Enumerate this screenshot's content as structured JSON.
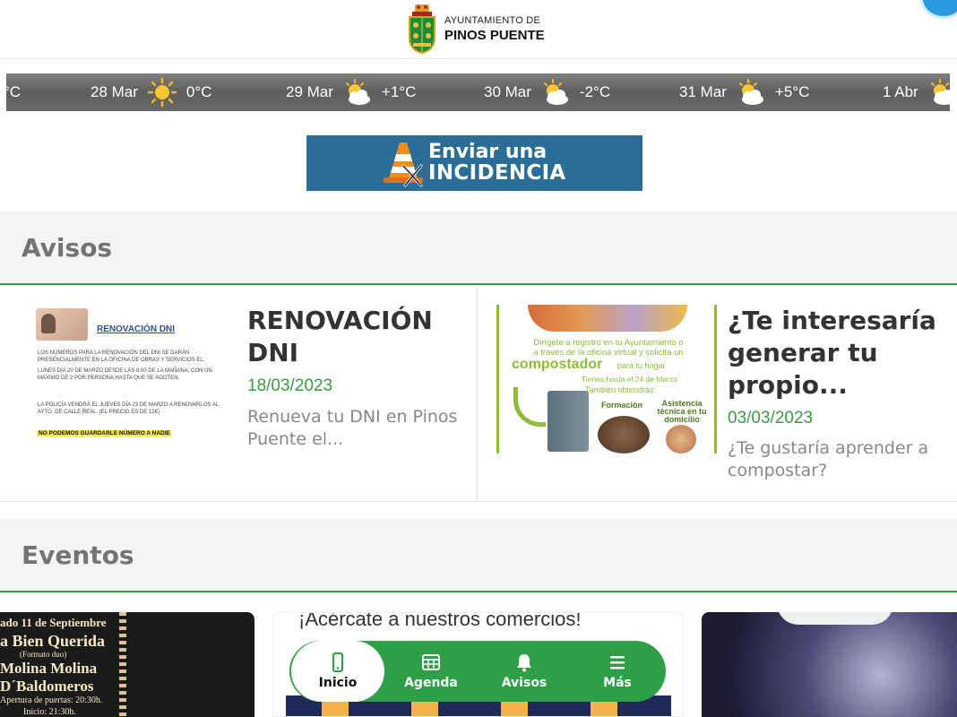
{
  "header": {
    "logo_line1": "AYUNTAMIENTO DE",
    "logo_line2": "PINOS PUENTE"
  },
  "weather": [
    {
      "date": "",
      "temp": "°C",
      "icon": "none"
    },
    {
      "date": "28 Mar",
      "temp": "0°C",
      "icon": "sun-icon"
    },
    {
      "date": "29 Mar",
      "temp": "+1°C",
      "icon": "partly-cloudy-icon"
    },
    {
      "date": "30 Mar",
      "temp": "-2°C",
      "icon": "partly-cloudy-icon"
    },
    {
      "date": "31 Mar",
      "temp": "+5°C",
      "icon": "partly-cloudy-icon"
    },
    {
      "date": "1 Abr",
      "temp": "",
      "icon": "partly-cloudy-icon"
    }
  ],
  "banner": {
    "line1": "Enviar una",
    "line2": "INCIDENCIA"
  },
  "avisos": {
    "title": "Avisos",
    "cards": [
      {
        "title": "RENOVACIÓN DNI",
        "date": "18/03/2023",
        "excerpt": "Renueva tu DNI en Pinos Puente el...",
        "thumb": {
          "heading": "RENOVACIÓN DNI",
          "p1": "LOS NÚMEROS PARA LA RENOVACIÓN DEL DNI SE DARÁN PRESENCIALMENTE EN LA OFICINA DE OBRAS Y SERVICIOS EL:",
          "p2": "LUNES DÍA 20 DE MARZO DESDE LAS 8:00 DE LA MAÑANA, CON UN MÁXIMO DE 2 POR PERSONA HASTA QUE SE AGOTEN.",
          "p3": "LA POLICÍA VENDRÁ EL JUEVES DÍA 23 DE MARZO A RENOVARLOS AL AYTO. DE CALLE REAL. (EL PRECIO ES DE 12€)",
          "highlight": "NO PODEMOS GUARDARLE NÚMERO A NADIE"
        }
      },
      {
        "title": "¿Te interesaría generar tu propio...",
        "date": "03/03/2023",
        "excerpt": "¿Te gustaría aprender a compostar?",
        "thumb": {
          "line1": "Dirígete a registro en tu Ayuntamiento o",
          "line2": "a través de la oficina virtual y solicita un",
          "big": "compostador",
          "big_suffix": "para tu hogar",
          "deadline": "Tienes hasta el 24 de Marzo",
          "also": "También obtendrás:",
          "label1": "Formación",
          "label2": "Asistencia técnica en tu domicilio"
        }
      }
    ]
  },
  "eventos": {
    "title": "Eventos",
    "cards": [
      {
        "lines": [
          "ado 11 de Septiembre",
          "a Bien Querida",
          "(Formato duo)",
          "Molina Molina",
          "D´Baldomeros",
          "Apertura de puertas: 20:30h.",
          "Inicio: 21:30h."
        ]
      },
      {
        "line": "¡Acércate a nuestros comercios!"
      },
      {}
    ]
  },
  "nav": [
    {
      "label": "Inicio",
      "icon": "phone-icon",
      "active": true
    },
    {
      "label": "Agenda",
      "icon": "calendar-icon",
      "active": false
    },
    {
      "label": "Avisos",
      "icon": "bell-icon",
      "active": false
    },
    {
      "label": "Más",
      "icon": "menu-icon",
      "active": false
    }
  ]
}
